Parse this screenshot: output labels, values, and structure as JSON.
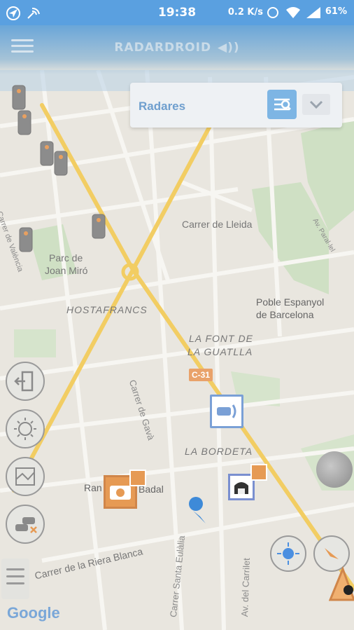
{
  "status_bar": {
    "time": "19:38",
    "speed": "0.2 K/s",
    "battery": "61%"
  },
  "app": {
    "title": "RADARDROID"
  },
  "filter": {
    "selected": "Radares"
  },
  "map": {
    "labels": {
      "carrer_lleida": "Carrer de Lleida",
      "parc_joan_miro_1": "Parc de",
      "parc_joan_miro_2": "Joan Miró",
      "hostafrancs": "HOSTAFRANCS",
      "poble_espanyol_1": "Poble Espanyol",
      "poble_espanyol_2": "de Barcelona",
      "font_guatlla_1": "LA FONT DE",
      "font_guatlla_2": "LA GUATLLA",
      "c31": "C-31",
      "carrer_gava": "Carrer de Gavà",
      "la_bordeta": "LA BORDETA",
      "riera_blanca": "Carrer de la Riera Blanca",
      "santa_eulalia": "Carrer Santa Eulàlia",
      "av_carrilet": "Av. del Carrilet",
      "carrer_valencia": "Carrer de València",
      "rambla_badal_1": "Ran",
      "rambla_badal_2": "Badal",
      "av_parallel": "Av. Paral·lel"
    }
  },
  "google_logo": "Google",
  "colors": {
    "status_bar": "#5aa0e0",
    "accent": "#7db5e4",
    "road_yellow": "#f2cd63",
    "badge_orange": "#e07b2a"
  }
}
